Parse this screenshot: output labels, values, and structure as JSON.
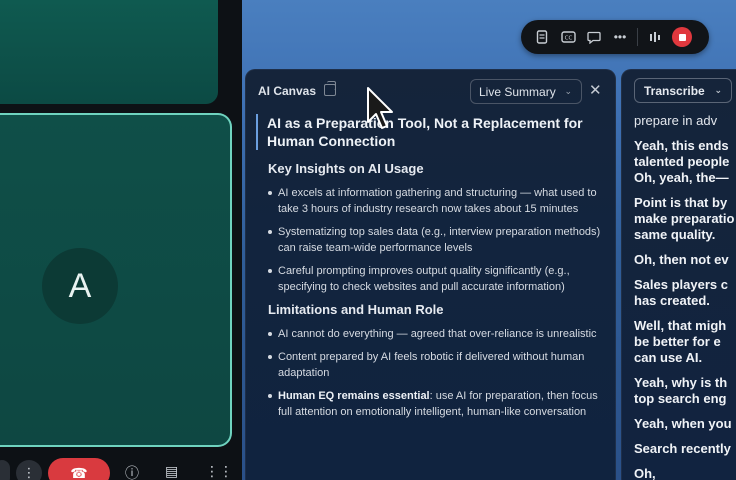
{
  "left": {
    "avatar_letter": "A",
    "bottom_buttons": [
      "more-options",
      "end-call",
      "info",
      "notes",
      "apps"
    ]
  },
  "toolbar": {
    "icons": [
      "document-icon",
      "captions-icon",
      "chat-icon",
      "more-icon",
      "audio-levels-icon",
      "stop-recording-icon"
    ],
    "stop_color": "#e0383e"
  },
  "canvas": {
    "title": "AI Canvas",
    "dropdown_label": "Live Summary",
    "heading": "AI as a Preparation Tool, Not a Replacement for Human Connection",
    "sections": [
      {
        "title": "Key Insights on AI Usage",
        "bullets": [
          {
            "text": "AI excels at information gathering and structuring — what used to take 3 hours of industry research now takes about 15 minutes"
          },
          {
            "text": "Systematizing top sales data (e.g., interview preparation methods) can raise team-wide performance levels"
          },
          {
            "text": "Careful prompting improves output quality significantly (e.g., specifying to check websites and pull accurate information)"
          }
        ]
      },
      {
        "title": "Limitations and Human Role",
        "bullets": [
          {
            "text": "AI cannot do everything — agreed that over-reliance is unrealistic"
          },
          {
            "text": "Content prepared by AI feels robotic if delivered without human adaptation"
          },
          {
            "bold": "Human EQ remains essential",
            "text": ": use AI for preparation, then focus full attention on emotionally intelligent, human-like conversation"
          }
        ]
      }
    ]
  },
  "transcribe": {
    "dropdown_label": "Transcribe",
    "lines": [
      {
        "text": "prepare in adv",
        "bold": false,
        "gap": false
      },
      {
        "text": "Yeah, this ends",
        "bold": true,
        "gap": true
      },
      {
        "text": "talented people",
        "bold": true,
        "gap": false
      },
      {
        "text": "Oh, yeah, the—",
        "bold": true,
        "gap": false
      },
      {
        "text": "Point is that by",
        "bold": true,
        "gap": true
      },
      {
        "text": "make preparatio",
        "bold": true,
        "gap": false
      },
      {
        "text": "same quality.",
        "bold": true,
        "gap": false
      },
      {
        "text": "Oh, then not ev",
        "bold": true,
        "gap": true
      },
      {
        "text": "Sales players c",
        "bold": true,
        "gap": true
      },
      {
        "text": "has created.",
        "bold": true,
        "gap": false
      },
      {
        "text": "Well, that migh",
        "bold": true,
        "gap": true
      },
      {
        "text": "be better for e",
        "bold": true,
        "gap": false
      },
      {
        "text": "can use AI.",
        "bold": true,
        "gap": false
      },
      {
        "text": "Yeah, why is th",
        "bold": true,
        "gap": true
      },
      {
        "text": "top search eng",
        "bold": true,
        "gap": false
      },
      {
        "text": "Yeah, when you",
        "bold": true,
        "gap": true
      },
      {
        "text": "Search recently",
        "bold": true,
        "gap": true
      },
      {
        "text": "Oh,",
        "bold": true,
        "gap": true
      }
    ]
  }
}
